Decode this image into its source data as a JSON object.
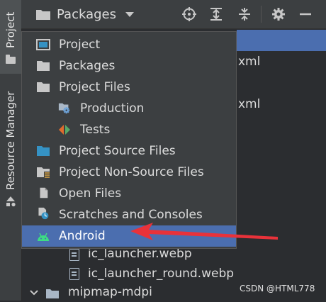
{
  "sidebar": {
    "project_tab": "Project",
    "resource_manager_tab": "Resource Manager"
  },
  "toolbar": {
    "view_selector": "Packages",
    "icons": [
      "folder-icon",
      "chevron-down-icon",
      "locate-icon",
      "expand-all-icon",
      "collapse-all-icon",
      "gear-icon",
      "minimize-icon"
    ]
  },
  "tree_behind": {
    "xml_1": "xml",
    "xml_2": "xml",
    "file_1": "ic_launcher.webp",
    "file_2": "ic_launcher_round.webp",
    "folder": "mipmap-mdpi"
  },
  "view_menu": {
    "items": [
      {
        "label": "Project",
        "icon": "project-view-icon"
      },
      {
        "label": "Packages",
        "icon": "folder-icon"
      },
      {
        "label": "Project Files",
        "icon": "folder-icon"
      },
      {
        "label": "Production",
        "icon": "production-gear-icon"
      },
      {
        "label": "Tests",
        "icon": "tests-icon"
      },
      {
        "label": "Project Source Files",
        "icon": "source-folder-icon"
      },
      {
        "label": "Project Non-Source Files",
        "icon": "non-source-folder-icon"
      },
      {
        "label": "Open Files",
        "icon": "open-files-icon"
      },
      {
        "label": "Scratches and Consoles",
        "icon": "scratches-icon"
      },
      {
        "label": "Android",
        "icon": "android-icon"
      }
    ],
    "selected": "Android"
  },
  "colors": {
    "selection": "#4b6eaf",
    "annotation_arrow": "#e8323a",
    "android_green": "#3ddc84"
  },
  "watermark": "CSDN @HTML778"
}
